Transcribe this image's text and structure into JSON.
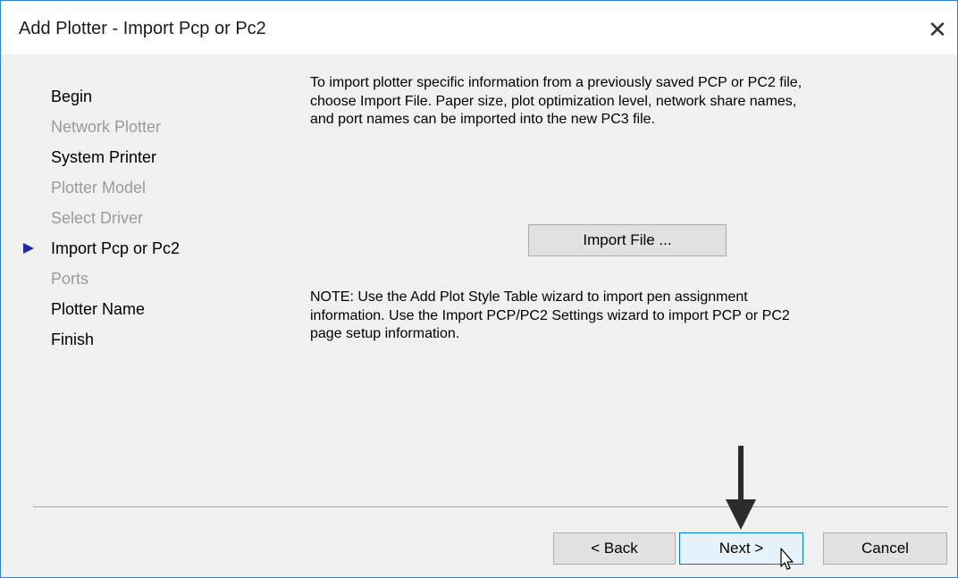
{
  "window": {
    "title": "Add Plotter - Import Pcp or Pc2",
    "close_glyph": "✕"
  },
  "steps": [
    {
      "label": "Begin",
      "state": "enabled"
    },
    {
      "label": "Network Plotter",
      "state": "disabled"
    },
    {
      "label": "System Printer",
      "state": "enabled"
    },
    {
      "label": "Plotter Model",
      "state": "disabled"
    },
    {
      "label": "Select Driver",
      "state": "disabled"
    },
    {
      "label": "Import Pcp or Pc2",
      "state": "current"
    },
    {
      "label": "Ports",
      "state": "disabled"
    },
    {
      "label": "Plotter Name",
      "state": "enabled"
    },
    {
      "label": "Finish",
      "state": "enabled"
    }
  ],
  "content": {
    "description": "To import plotter specific information from a previously saved PCP or PC2 file, choose Import File. Paper size, plot optimization level, network share names, and port names can be imported into the new PC3 file.",
    "import_button": "Import File ...",
    "note": "NOTE: Use the Add Plot Style Table wizard to import pen assignment information. Use the Import PCP/PC2 Settings wizard to import PCP or PC2 page setup information."
  },
  "footer": {
    "back": "< Back",
    "next": "Next >",
    "cancel": "Cancel"
  },
  "colors": {
    "accent_border": "#2b83d6",
    "current_step_marker": "#1c2ba8",
    "disabled_text": "#9b9b9b",
    "focused_button_border": "#0078d7",
    "annotation_arrow": "#2b2b2b"
  },
  "icons": {
    "close": "close-icon",
    "current_step": "current-step-marker-icon",
    "annotation": "down-arrow-annotation",
    "pointer": "mouse-pointer-icon"
  }
}
